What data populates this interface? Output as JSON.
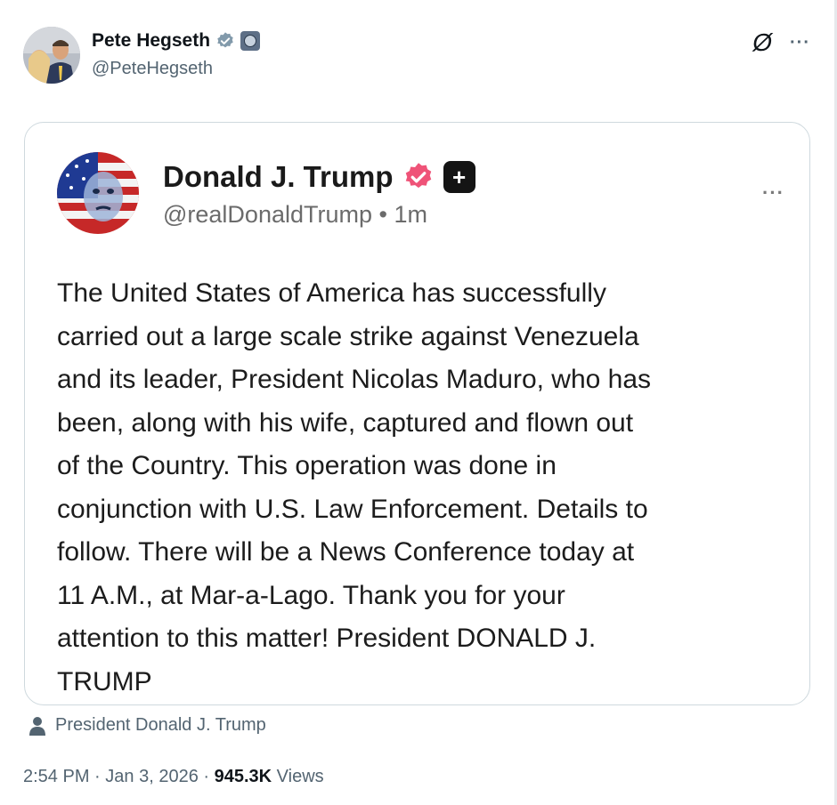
{
  "post": {
    "author": {
      "name": "Pete Hegseth",
      "handle": "@PeteHegseth",
      "verified_color": "#829aab"
    },
    "quoted": {
      "name": "Donald J. Trump",
      "handle": "@realDonaldTrump",
      "separator": "•",
      "time": "1m",
      "badge_symbol": "+",
      "verified_color": "#ef5378",
      "body": "The United States of America has successfully\ncarried out a large scale strike against Venezuela\nand its leader, President Nicolas Maduro, who has\nbeen, along with his wife, captured and flown out\nof the Country. This operation was done in\nconjunction with U.S. Law Enforcement. Details to\nfollow. There will be a News Conference today at\n11 A.M., at Mar-a-Lago. Thank you for your\nattention to this matter! President DONALD J.\nTRUMP"
    },
    "attribution": "President Donald J. Trump",
    "time": "2:54 PM",
    "date": "Jan 3, 2026",
    "views_count": "945.3K",
    "views_label": "Views",
    "dot": "·",
    "icons": {
      "grok": "Ø",
      "more": "···"
    }
  }
}
